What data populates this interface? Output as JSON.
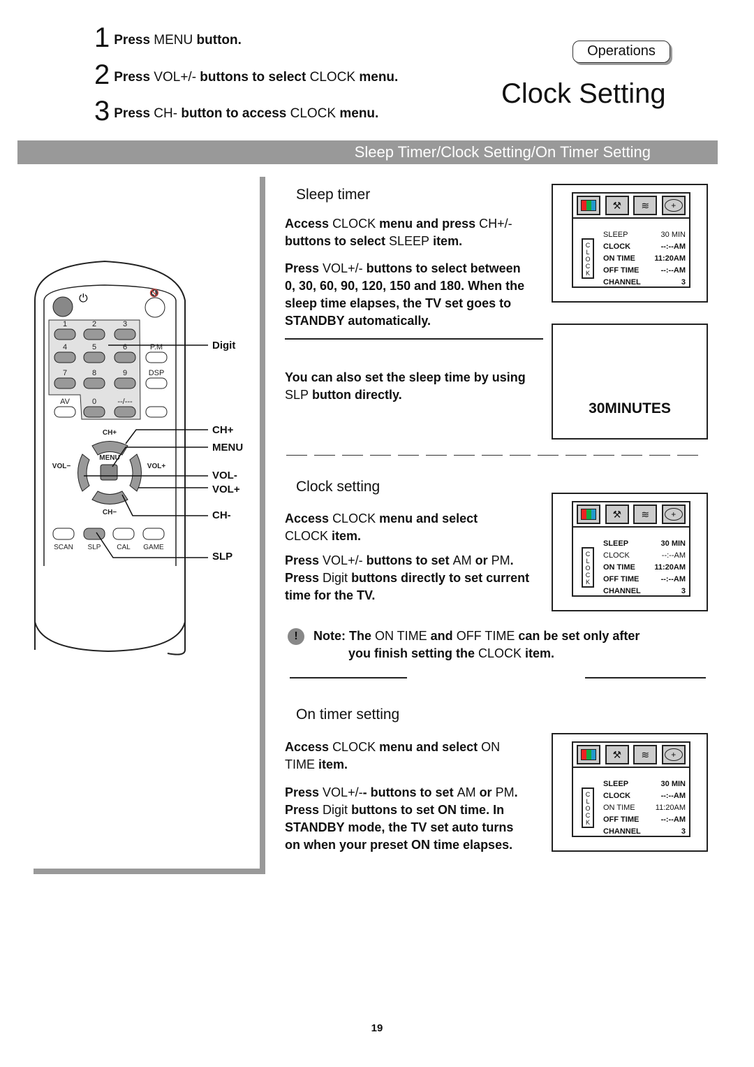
{
  "steps": [
    {
      "num": "1",
      "segments": [
        {
          "t": "Press ",
          "b": true
        },
        {
          "t": "MENU",
          "b": false
        },
        {
          "t": " button.",
          "b": true
        }
      ]
    },
    {
      "num": "2",
      "segments": [
        {
          "t": "Press ",
          "b": true
        },
        {
          "t": "VOL+/-",
          "b": false
        },
        {
          "t": " buttons to select ",
          "b": true
        },
        {
          "t": "CLOCK",
          "b": false
        },
        {
          "t": " menu.",
          "b": true
        }
      ]
    },
    {
      "num": "3",
      "segments": [
        {
          "t": "Press ",
          "b": true
        },
        {
          "t": "CH-",
          "b": false
        },
        {
          "t": " button to access ",
          "b": true
        },
        {
          "t": "CLOCK",
          "b": false
        },
        {
          "t": " menu.",
          "b": true
        }
      ]
    }
  ],
  "header": {
    "section_badge": "Operations",
    "title": "Clock Setting",
    "banner": "Sleep Timer/Clock Setting/On Timer Setting"
  },
  "remote": {
    "keys": [
      "1",
      "2",
      "3",
      "4",
      "5",
      "6",
      "7",
      "8",
      "9",
      "0",
      "--/---",
      "AV",
      "P.M",
      "DSP",
      "CH+",
      "CH−",
      "MENU",
      "VOL−",
      "VOL+",
      "SCAN",
      "SLP",
      "CAL",
      "GAME"
    ],
    "callouts": [
      "Digit",
      "CH+",
      "MENU",
      "VOL-",
      "VOL+",
      "CH-",
      "SLP"
    ]
  },
  "sleep": {
    "heading": "Sleep timer",
    "p1": [
      {
        "t": "Access ",
        "b": true
      },
      {
        "t": "CLOCK",
        "b": false
      },
      {
        "t": " menu and press ",
        "b": true
      },
      {
        "t": "CH+/-",
        "b": false
      },
      {
        "t": "\nbuttons to select ",
        "b": true
      },
      {
        "t": "SLEEP",
        "b": false
      },
      {
        "t": " item.",
        "b": true
      }
    ],
    "p2": [
      {
        "t": "Press ",
        "b": true
      },
      {
        "t": "VOL+/-",
        "b": false
      },
      {
        "t": " buttons to select between\n0, 30, 60, 90, 120, 150 and 180. When the\nsleep time elapses, the TV set goes to\nSTANDBY automatically.",
        "b": true
      }
    ],
    "p3": [
      {
        "t": "You can also set the sleep time by using\n",
        "b": true
      },
      {
        "t": "SLP",
        "b": false
      },
      {
        "t": " button directly.",
        "b": true
      }
    ],
    "display": "30MINUTES"
  },
  "clock": {
    "heading": "Clock setting",
    "p1": [
      {
        "t": "Access ",
        "b": true
      },
      {
        "t": "CLOCK",
        "b": false
      },
      {
        "t": " menu and select\n",
        "b": true
      },
      {
        "t": "CLOCK",
        "b": false
      },
      {
        "t": " item.",
        "b": true
      }
    ],
    "p2": [
      {
        "t": "Press ",
        "b": true
      },
      {
        "t": "VOL+/-",
        "b": false
      },
      {
        "t": " buttons to set ",
        "b": true
      },
      {
        "t": "AM",
        "b": false
      },
      {
        "t": " or ",
        "b": true
      },
      {
        "t": "PM",
        "b": false
      },
      {
        "t": ".\nPress ",
        "b": true
      },
      {
        "t": "Digit",
        "b": false
      },
      {
        "t": " buttons directly to set current\ntime for the TV.",
        "b": true
      }
    ],
    "note": [
      {
        "t": "Note: The ",
        "b": true
      },
      {
        "t": "ON TIME",
        "b": false
      },
      {
        "t": " and ",
        "b": true
      },
      {
        "t": "OFF TIME",
        "b": false
      },
      {
        "t": " can be set only after\n          you finish setting the ",
        "b": true
      },
      {
        "t": "CLOCK",
        "b": false
      },
      {
        "t": " item.",
        "b": true
      }
    ]
  },
  "ontimer": {
    "heading": "On timer setting",
    "p1": [
      {
        "t": "Access ",
        "b": true
      },
      {
        "t": "CLOCK",
        "b": false
      },
      {
        "t": " menu and select ",
        "b": true
      },
      {
        "t": "ON\nTIME",
        "b": false
      },
      {
        "t": " item.",
        "b": true
      }
    ],
    "p2": [
      {
        "t": "Press ",
        "b": true
      },
      {
        "t": "VOL+/-",
        "b": false
      },
      {
        "t": "- buttons to set ",
        "b": true
      },
      {
        "t": "AM",
        "b": false
      },
      {
        "t": " or ",
        "b": true
      },
      {
        "t": "PM",
        "b": false
      },
      {
        "t": ".\nPress ",
        "b": true
      },
      {
        "t": "Digit",
        "b": false
      },
      {
        "t": " buttons to set ON time. In\nSTANDBY mode, the TV set auto turns\non when your preset ON time elapses.",
        "b": true
      }
    ]
  },
  "menus": [
    {
      "side_label": "CLOCK",
      "rows": [
        {
          "k": "SLEEP",
          "v": "30 MIN",
          "bold": false
        },
        {
          "k": "CLOCK",
          "v": "--:--AM",
          "bold": true
        },
        {
          "k": "ON TIME",
          "v": "11:20AM",
          "bold": true
        },
        {
          "k": "OFF TIME",
          "v": "--:--AM",
          "bold": true
        },
        {
          "k": "CHANNEL",
          "v": "3",
          "bold": true
        }
      ]
    },
    {
      "side_label": "CLOCK",
      "rows": [
        {
          "k": "SLEEP",
          "v": "30 MIN",
          "bold": true
        },
        {
          "k": "CLOCK",
          "v": "--:--AM",
          "bold": false
        },
        {
          "k": "ON TIME",
          "v": "11:20AM",
          "bold": true
        },
        {
          "k": "OFF TIME",
          "v": "--:--AM",
          "bold": true
        },
        {
          "k": "CHANNEL",
          "v": "3",
          "bold": true
        }
      ]
    },
    {
      "side_label": "CLOCK",
      "rows": [
        {
          "k": "SLEEP",
          "v": "30 MIN",
          "bold": true
        },
        {
          "k": "CLOCK",
          "v": "--:--AM",
          "bold": true
        },
        {
          "k": "ON TIME",
          "v": "11:20AM",
          "bold": false
        },
        {
          "k": "OFF TIME",
          "v": "--:--AM",
          "bold": true
        },
        {
          "k": "CHANNEL",
          "v": "3",
          "bold": true
        }
      ]
    }
  ],
  "page_number": "19",
  "colors": {
    "banner": "#999999",
    "key_gray": "#999999"
  }
}
